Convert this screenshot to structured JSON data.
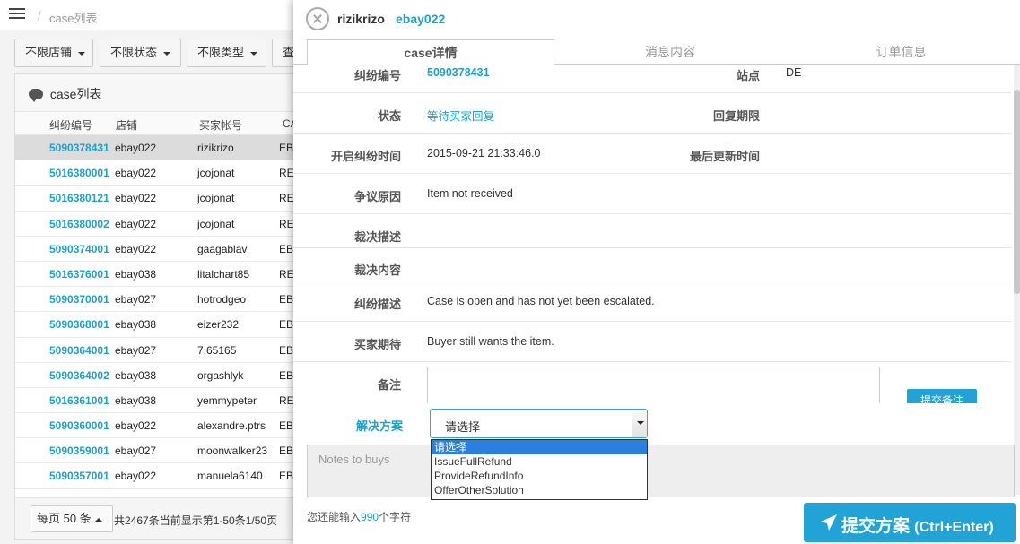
{
  "breadcrumb": {
    "current": "case列表"
  },
  "filters": [
    "不限店铺",
    "不限状态",
    "不限类型",
    "查"
  ],
  "list_panel": {
    "title": "case列表",
    "columns": [
      "纠纷编号",
      "店铺",
      "买家帐号",
      "CA"
    ],
    "rows": [
      {
        "id": "5090378431",
        "shop": "ebay022",
        "buyer": "rizikrizo",
        "type": "EB",
        "selected": true
      },
      {
        "id": "5016380001",
        "shop": "ebay022",
        "buyer": "jcojonat",
        "type": "RE"
      },
      {
        "id": "5016380121",
        "shop": "ebay022",
        "buyer": "jcojonat",
        "type": "RE"
      },
      {
        "id": "5016380002",
        "shop": "ebay022",
        "buyer": "jcojonat",
        "type": "RE"
      },
      {
        "id": "5090374001",
        "shop": "ebay022",
        "buyer": "gaagablav",
        "type": "EB"
      },
      {
        "id": "5016376001",
        "shop": "ebay038",
        "buyer": "litalchart85",
        "type": "RE"
      },
      {
        "id": "5090370001",
        "shop": "ebay027",
        "buyer": "hotrodgeo",
        "type": "EB"
      },
      {
        "id": "5090368001",
        "shop": "ebay038",
        "buyer": "eizer232",
        "type": "EB"
      },
      {
        "id": "5090364001",
        "shop": "ebay027",
        "buyer": "7.65165",
        "type": "EB"
      },
      {
        "id": "5090364002",
        "shop": "ebay038",
        "buyer": "orgashlyk",
        "type": "EB"
      },
      {
        "id": "5016361001",
        "shop": "ebay038",
        "buyer": "yemmypeter",
        "type": "RE"
      },
      {
        "id": "5090360001",
        "shop": "ebay022",
        "buyer": "alexandre.ptrs",
        "type": "EB"
      },
      {
        "id": "5090359001",
        "shop": "ebay027",
        "buyer": "moonwalker23",
        "type": "EB"
      },
      {
        "id": "5090357001",
        "shop": "ebay022",
        "buyer": "manuela6140",
        "type": "EB"
      }
    ],
    "page_size_label": "每页 50 条",
    "page_info": "共2467条当前显示第1-50条1/50页"
  },
  "drawer": {
    "buyer": "rizikrizo",
    "shop": "ebay022",
    "tabs": [
      "case详情",
      "消息内容",
      "订单信息"
    ],
    "active_tab": 0,
    "fields": {
      "case_id_label": "纠纷编号",
      "case_id": "5090378431",
      "site_label": "站点",
      "site": "DE",
      "status_label": "状态",
      "status": "等待买家回复",
      "reply_deadline_label": "回复期限",
      "reply_deadline": "",
      "open_time_label": "开启纠纷时间",
      "open_time": "2015-09-21 21:33:46.0",
      "last_update_label": "最后更新时间",
      "last_update": "",
      "reason_label": "争议原因",
      "reason": "Item not received",
      "ruling_desc_label": "裁决描述",
      "ruling_desc": "",
      "ruling_content_label": "裁决内容",
      "ruling_content": "",
      "case_desc_label": "纠纷描述",
      "case_desc": "Case is open and has not yet been escalated.",
      "buyer_expect_label": "买家期待",
      "buyer_expect": "Buyer still wants the item.",
      "note_label": "备注",
      "note_button": "提交备注"
    },
    "solution": {
      "label": "解决方案",
      "selected": "请选择",
      "options": [
        "请选择",
        "IssueFullRefund",
        "ProvideRefundInfo",
        "OfferOtherSolution"
      ]
    },
    "message": {
      "placeholder": "Notes to buys",
      "remain_prefix": "您还能输入",
      "remain_count": "990",
      "remain_suffix": "个字符"
    },
    "submit": {
      "label": "提交方案",
      "shortcut": "(Ctrl+Enter)"
    }
  },
  "colors": {
    "accent": "#21a3d6",
    "link": "#1fa0c8",
    "selected_option": "#2a7fe0"
  }
}
